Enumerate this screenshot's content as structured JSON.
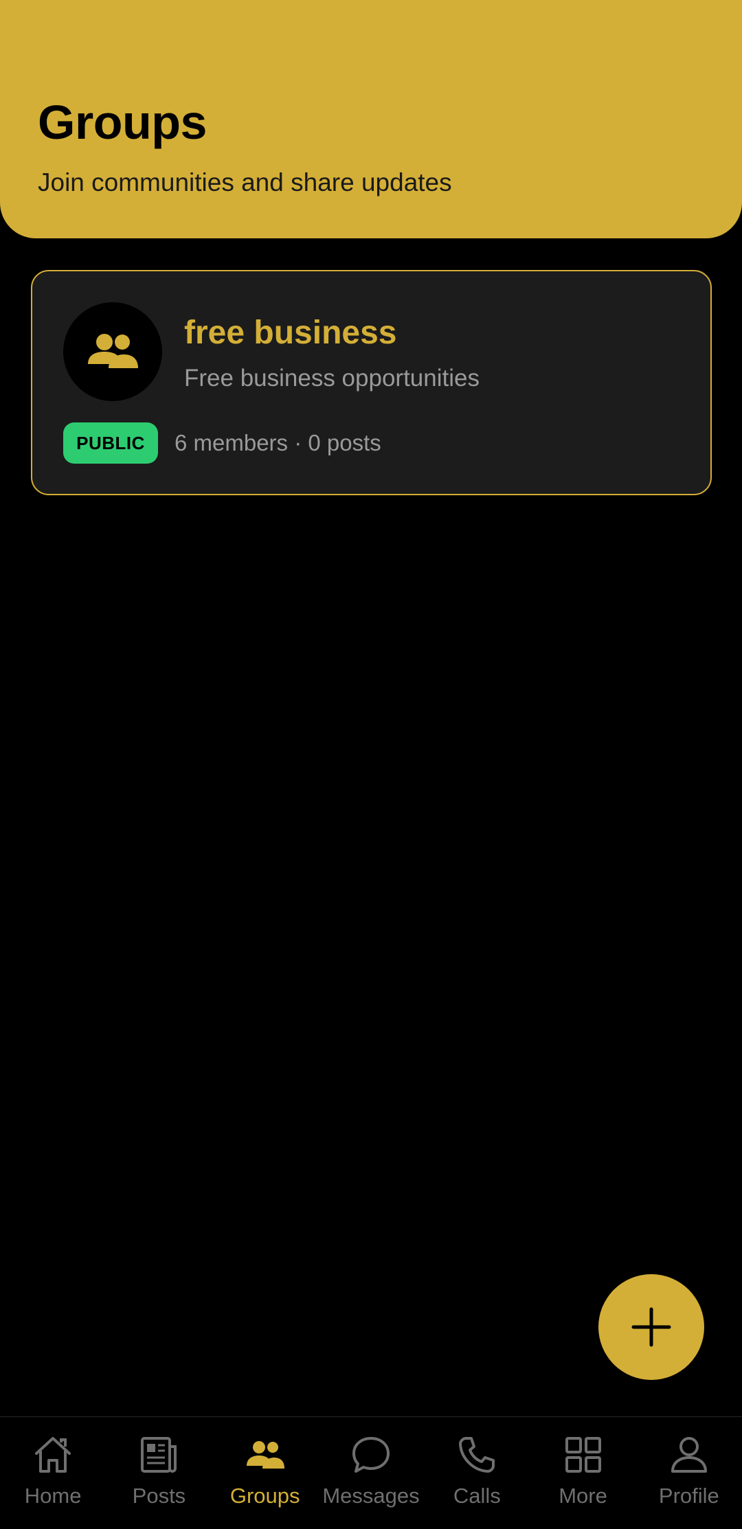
{
  "colors": {
    "accent": "#D4AF37",
    "background": "#000000",
    "card": "#1c1c1c",
    "badge_public": "#2ECC71",
    "muted": "#9a9a9a",
    "nav_inactive": "#6f6f6f"
  },
  "header": {
    "title": "Groups",
    "subtitle": "Join communities and share updates"
  },
  "groups": [
    {
      "name": "free business",
      "description": "Free business opportunities",
      "visibility": "PUBLIC",
      "stats": "6 members · 0 posts",
      "icon": "group-people-icon"
    }
  ],
  "fab": {
    "icon": "plus-icon"
  },
  "bottom_nav": {
    "active": "Groups",
    "items": [
      {
        "label": "Home",
        "icon": "home-icon"
      },
      {
        "label": "Posts",
        "icon": "newspaper-icon"
      },
      {
        "label": "Groups",
        "icon": "groups-icon"
      },
      {
        "label": "Messages",
        "icon": "chat-bubble-icon"
      },
      {
        "label": "Calls",
        "icon": "phone-icon"
      },
      {
        "label": "More",
        "icon": "grid-icon"
      },
      {
        "label": "Profile",
        "icon": "person-icon"
      }
    ]
  }
}
